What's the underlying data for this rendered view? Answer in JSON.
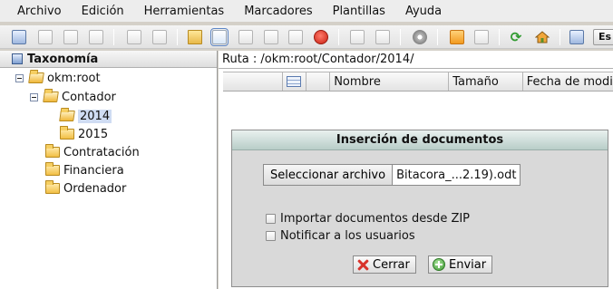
{
  "menu": [
    "Archivo",
    "Edición",
    "Herramientas",
    "Marcadores",
    "Plantillas",
    "Ayuda"
  ],
  "toolbar": {
    "icons": [
      "find-icon",
      "document-icon",
      "document-edit-icon",
      "print-icon",
      "lock-icon",
      "unlock-icon",
      "add-folder-icon",
      "add-document-icon",
      "image-icon",
      "copy-icon",
      "copy-icon-2",
      "stop-icon",
      "checkout-icon",
      "checkin-icon",
      "gear-icon",
      "download-icon",
      "upload-icon",
      "refresh-icon",
      "home-icon",
      "export-icon"
    ],
    "cut_label": "Es"
  },
  "taxonomy": {
    "title": "Taxonomía",
    "tree": [
      {
        "label": "okm:root"
      },
      {
        "label": "Contador"
      },
      {
        "label": "2014",
        "selected": true
      },
      {
        "label": "2015"
      },
      {
        "label": "Contratación"
      },
      {
        "label": "Financiera"
      },
      {
        "label": "Ordenador"
      }
    ]
  },
  "path": "Ruta : /okm:root/Contador/2014/",
  "grid": {
    "columns": [
      "",
      "",
      "",
      "Nombre",
      "Tamaño",
      "Fecha de modificación"
    ]
  },
  "dialog": {
    "title": "Inserción de documentos",
    "file_button": "Seleccionar archivo",
    "file_name": "Bitacora_...2.19).odt",
    "options": [
      "Importar documentos desde ZIP",
      "Notificar a los usuarios"
    ],
    "cancel_label": "Cerrar",
    "send_label": "Enviar"
  }
}
